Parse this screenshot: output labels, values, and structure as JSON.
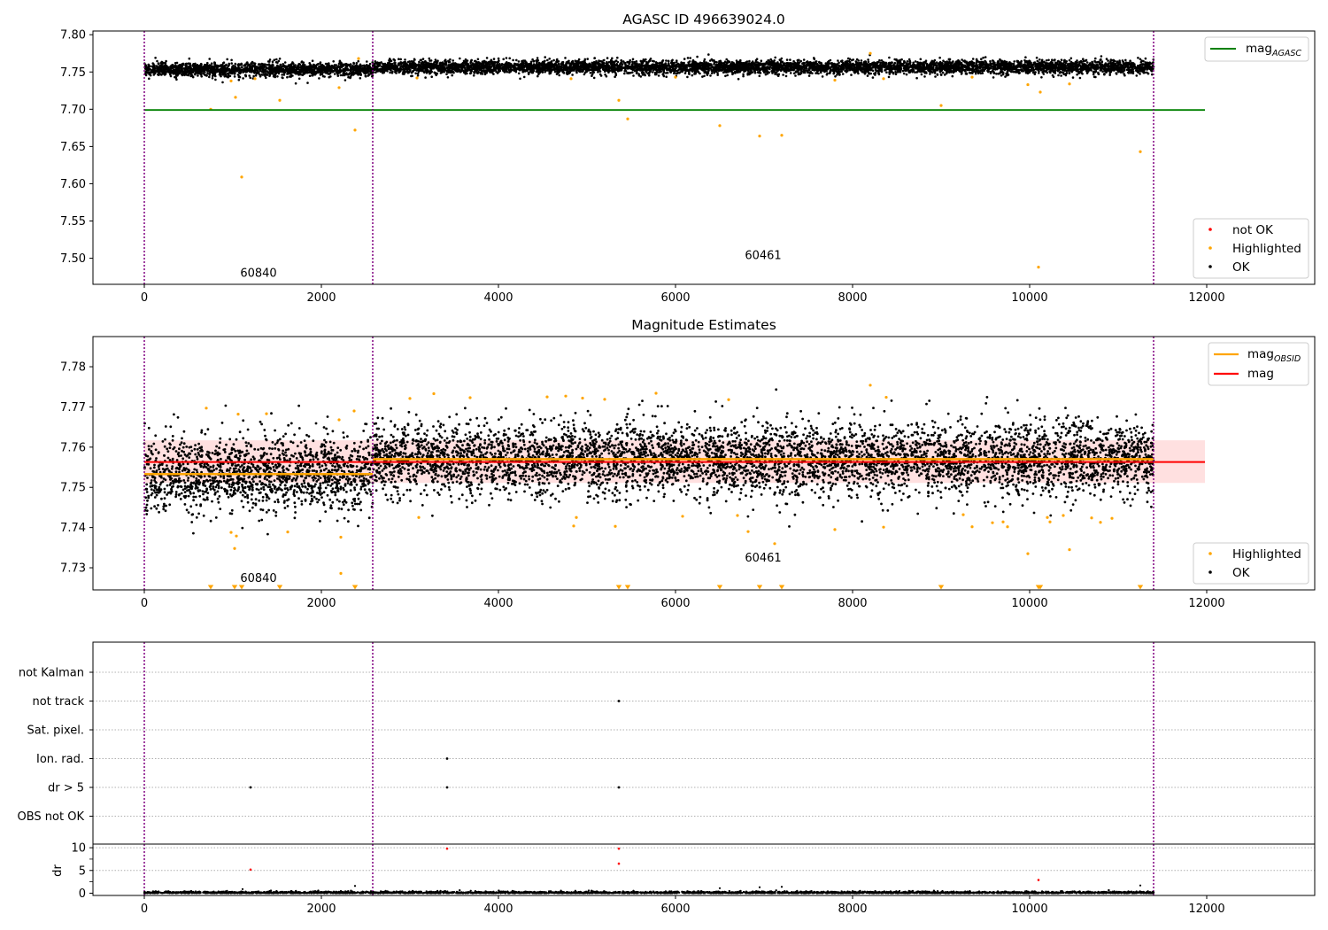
{
  "figure": {
    "background": "#ffffff"
  },
  "chart_data": [
    {
      "type": "scatter",
      "title": "AGASC ID 496639024.0",
      "xlim": [
        -580,
        13220
      ],
      "ylim": [
        7.465,
        7.805
      ],
      "xticks": [
        0,
        2000,
        4000,
        6000,
        8000,
        10000,
        12000
      ],
      "xtick_labels": [
        "0",
        "2000",
        "4000",
        "6000",
        "8000",
        "10000",
        "12000"
      ],
      "yticks": [
        7.5,
        7.55,
        7.6,
        7.65,
        7.7,
        7.75,
        7.8
      ],
      "ytick_labels": [
        "7.50",
        "7.55",
        "7.60",
        "7.65",
        "7.70",
        "7.75",
        "7.80"
      ],
      "obsid_boundaries": [
        0,
        2580,
        11400
      ],
      "obsid_labels": [
        {
          "text": "60840",
          "x": 1290,
          "y": 7.475
        },
        {
          "text": "60461",
          "x": 6990,
          "y": 7.499
        }
      ],
      "mag_agasc": {
        "value": 7.699,
        "x_range": [
          0,
          11980
        ],
        "color": "#008000"
      },
      "ok_band": [
        {
          "x_range": [
            0,
            2580
          ],
          "center": 7.7535,
          "spread": 0.0045
        },
        {
          "x_range": [
            2580,
            11400
          ],
          "center": 7.7565,
          "spread": 0.0045
        }
      ],
      "highlighted_points": [
        [
          750,
          7.7
        ],
        [
          980,
          7.738
        ],
        [
          1030,
          7.716
        ],
        [
          1100,
          7.609
        ],
        [
          1250,
          7.741
        ],
        [
          1530,
          7.712
        ],
        [
          2200,
          7.729
        ],
        [
          2380,
          7.672
        ],
        [
          2420,
          7.768
        ],
        [
          3080,
          7.742
        ],
        [
          4820,
          7.741
        ],
        [
          5360,
          7.712
        ],
        [
          5460,
          7.687
        ],
        [
          6000,
          7.743
        ],
        [
          6500,
          7.678
        ],
        [
          6950,
          7.664
        ],
        [
          7200,
          7.665
        ],
        [
          7800,
          7.739
        ],
        [
          8200,
          7.775
        ],
        [
          8350,
          7.741
        ],
        [
          9000,
          7.705
        ],
        [
          9350,
          7.743
        ],
        [
          9980,
          7.733
        ],
        [
          10100,
          7.488
        ],
        [
          10120,
          7.723
        ],
        [
          10450,
          7.734
        ],
        [
          11250,
          7.643
        ]
      ],
      "legends": [
        {
          "entries": [
            {
              "label": "mag",
              "subscript": "AGASC",
              "kind": "line",
              "color": "#008000"
            }
          ],
          "position": "upper right"
        },
        {
          "entries": [
            {
              "label": "not OK",
              "kind": "dot",
              "color": "#ff0000"
            },
            {
              "label": "Highlighted",
              "kind": "dot",
              "color": "#ffa500"
            },
            {
              "label": "OK",
              "kind": "dot",
              "color": "#000000"
            }
          ],
          "position": "lower right"
        }
      ]
    },
    {
      "type": "scatter",
      "title": "Magnitude Estimates",
      "xlim": [
        -580,
        13220
      ],
      "ylim": [
        7.7245,
        7.7875
      ],
      "xticks": [
        0,
        2000,
        4000,
        6000,
        8000,
        10000,
        12000
      ],
      "xtick_labels": [
        "0",
        "2000",
        "4000",
        "6000",
        "8000",
        "10000",
        "12000"
      ],
      "yticks": [
        7.73,
        7.74,
        7.75,
        7.76,
        7.77,
        7.78
      ],
      "ytick_labels": [
        "7.73",
        "7.74",
        "7.75",
        "7.76",
        "7.77",
        "7.78"
      ],
      "obsid_boundaries": [
        0,
        2580,
        11400
      ],
      "obsid_labels": [
        {
          "text": "60840",
          "x": 1290,
          "y": 7.7265
        },
        {
          "text": "60461",
          "x": 6990,
          "y": 7.7315
        }
      ],
      "mag_line": {
        "value": 7.7563,
        "x_range": [
          0,
          11980
        ],
        "color": "#ff0000",
        "band": [
          7.7511,
          7.7617
        ]
      },
      "mag_obsid": [
        {
          "x_range": [
            0,
            2580
          ],
          "value": 7.7533
        },
        {
          "x_range": [
            2580,
            11400
          ],
          "value": 7.757
        }
      ],
      "ok_band": [
        {
          "x_range": [
            0,
            2580
          ],
          "center": 7.7533,
          "spread": 0.0045
        },
        {
          "x_range": [
            2580,
            11400
          ],
          "center": 7.757,
          "spread": 0.0045
        }
      ],
      "highlighted_points": [
        [
          700,
          7.7697
        ],
        [
          980,
          7.7388
        ],
        [
          1020,
          7.7348
        ],
        [
          1040,
          7.7379
        ],
        [
          1060,
          7.7682
        ],
        [
          1380,
          7.7683
        ],
        [
          1620,
          7.7389
        ],
        [
          2200,
          7.7668
        ],
        [
          2220,
          7.7376
        ],
        [
          2220,
          7.7286
        ],
        [
          2370,
          7.769
        ],
        [
          3000,
          7.7721
        ],
        [
          3100,
          7.7425
        ],
        [
          3270,
          7.7733
        ],
        [
          3680,
          7.7723
        ],
        [
          4550,
          7.7725
        ],
        [
          4760,
          7.7727
        ],
        [
          4850,
          7.7404
        ],
        [
          4880,
          7.7425
        ],
        [
          4950,
          7.7722
        ],
        [
          5200,
          7.7719
        ],
        [
          5320,
          7.7403
        ],
        [
          5780,
          7.7734
        ],
        [
          6080,
          7.7428
        ],
        [
          6600,
          7.7718
        ],
        [
          6700,
          7.743
        ],
        [
          6820,
          7.739
        ],
        [
          7120,
          7.736
        ],
        [
          7800,
          7.7395
        ],
        [
          8200,
          7.7754
        ],
        [
          8350,
          7.7401
        ],
        [
          8380,
          7.7724
        ],
        [
          9250,
          7.7432
        ],
        [
          9350,
          7.7402
        ],
        [
          9580,
          7.7412
        ],
        [
          9700,
          7.7414
        ],
        [
          9750,
          7.7402
        ],
        [
          9980,
          7.7335
        ],
        [
          10200,
          7.7425
        ],
        [
          10230,
          7.7414
        ],
        [
          10380,
          7.743
        ],
        [
          10450,
          7.7345
        ],
        [
          10700,
          7.7424
        ],
        [
          10800,
          7.7413
        ],
        [
          10930,
          7.7423
        ]
      ],
      "clipped_below_x": [
        750,
        1020,
        1100,
        1530,
        2380,
        5360,
        5460,
        6500,
        6950,
        7200,
        9000,
        10100,
        10120,
        11250
      ],
      "legends": [
        {
          "entries": [
            {
              "label": "mag",
              "subscript": "OBSID",
              "kind": "line",
              "color": "#ffa500"
            },
            {
              "label": "mag",
              "kind": "line",
              "color": "#ff0000"
            }
          ],
          "position": "upper right"
        },
        {
          "entries": [
            {
              "label": "Highlighted",
              "kind": "dot",
              "color": "#ffa500"
            },
            {
              "label": "OK",
              "kind": "dot",
              "color": "#000000"
            }
          ],
          "position": "lower right"
        }
      ]
    },
    {
      "type": "scatter",
      "title": "",
      "xlim": [
        -580,
        13220
      ],
      "categories": [
        "not Kalman",
        "not track",
        "Sat. pixel.",
        "Ion. rad.",
        "dr > 5",
        "OBS not OK"
      ],
      "obsid_boundaries": [
        0,
        2580,
        11400
      ],
      "flag_points": [
        {
          "category": "not track",
          "x": 5360
        },
        {
          "category": "Ion. rad.",
          "x": 3420
        },
        {
          "category": "dr > 5",
          "x": 1200
        },
        {
          "category": "dr > 5",
          "x": 3420
        },
        {
          "category": "dr > 5",
          "x": 5360
        }
      ]
    },
    {
      "type": "scatter",
      "title": "",
      "ylabel": "dr",
      "xlim": [
        -580,
        13220
      ],
      "ylim": [
        -0.5,
        10.8
      ],
      "xticks": [
        0,
        2000,
        4000,
        6000,
        8000,
        10000,
        12000
      ],
      "xtick_labels": [
        "0",
        "2000",
        "4000",
        "6000",
        "8000",
        "10000",
        "12000"
      ],
      "yticks": [
        0,
        5,
        10
      ],
      "ytick_labels": [
        "0",
        "5",
        "10"
      ],
      "obsid_boundaries": [
        0,
        2580,
        11400
      ],
      "points_black": [
        [
          1110,
          0.9
        ],
        [
          2380,
          1.6
        ],
        [
          6500,
          1.1
        ],
        [
          6950,
          1.3
        ],
        [
          7200,
          1.4
        ],
        [
          11250,
          1.7
        ]
      ],
      "points_red": [
        [
          1200,
          5.2
        ],
        [
          3420,
          9.8
        ],
        [
          5360,
          9.8
        ],
        [
          5360,
          6.5
        ],
        [
          10100,
          2.9
        ]
      ]
    }
  ]
}
